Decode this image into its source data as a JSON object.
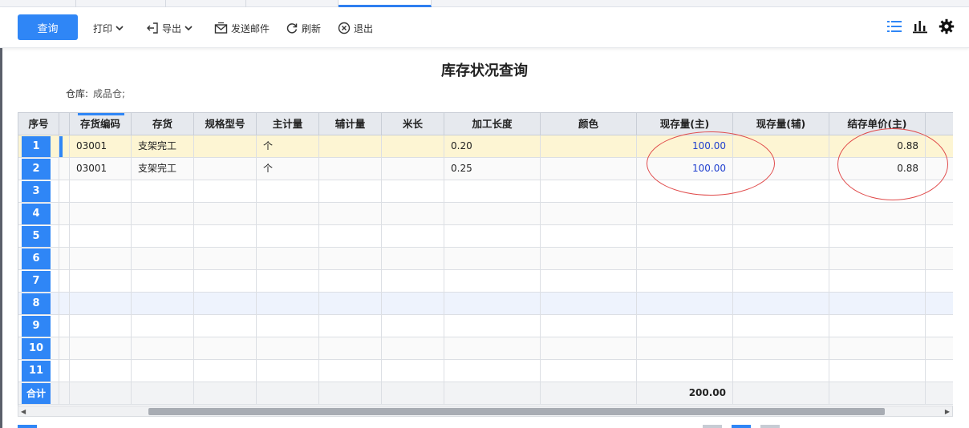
{
  "toolbar": {
    "query": "查询",
    "print": "打印",
    "export": "导出",
    "send_mail": "发送邮件",
    "refresh": "刷新",
    "exit": "退出"
  },
  "report": {
    "title": "库存状况查询",
    "warehouse_label": "仓库:",
    "warehouse_value": "成品仓;"
  },
  "grid": {
    "columns": [
      "序号",
      "存货编码",
      "存货",
      "规格型号",
      "主计量",
      "辅计量",
      "米长",
      "加工长度",
      "颜色",
      "现存量(主)",
      "现存量(辅)",
      "结存单价(主)"
    ],
    "rows": [
      {
        "no": "1",
        "code": "03001",
        "item": "支架完工",
        "spec": "",
        "unit": "个",
        "aux_unit": "",
        "meter": "",
        "length": "0.20",
        "color": "",
        "qty_main": "100.00",
        "qty_aux": "",
        "price": "0.88"
      },
      {
        "no": "2",
        "code": "03001",
        "item": "支架完工",
        "spec": "",
        "unit": "个",
        "aux_unit": "",
        "meter": "",
        "length": "0.25",
        "color": "",
        "qty_main": "100.00",
        "qty_aux": "",
        "price": "0.88"
      }
    ],
    "empty_rows": [
      "3",
      "4",
      "5",
      "6",
      "7",
      "8",
      "9",
      "10",
      "11"
    ],
    "total_label": "合计",
    "total_qty_main": "200.00"
  },
  "icons": [
    "print-chevron-icon",
    "export-icon",
    "mail-icon",
    "refresh-icon",
    "exit-icon",
    "list-view-icon",
    "chart-icon",
    "settings-gear-icon"
  ],
  "colors": {
    "accent": "#2f86f6",
    "selected_row": "#fdf5d3",
    "annotation": "#e04a4a",
    "qty_text": "#1f3fcf"
  }
}
